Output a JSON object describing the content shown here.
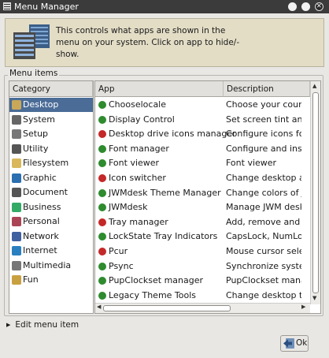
{
  "window": {
    "title": "Menu Manager"
  },
  "banner": {
    "text": "This controls what apps are shown in the menu on your system. Click on app to hide/-show."
  },
  "menu_items": {
    "label": "Menu items",
    "category_header": "Category",
    "categories": [
      {
        "label": "Desktop",
        "icon": "desktop-folder-icon",
        "selected": true
      },
      {
        "label": "System",
        "icon": "system-icon"
      },
      {
        "label": "Setup",
        "icon": "setup-tools-icon"
      },
      {
        "label": "Utility",
        "icon": "utility-gear-icon"
      },
      {
        "label": "Filesystem",
        "icon": "folder-icon"
      },
      {
        "label": "Graphic",
        "icon": "graphic-icon"
      },
      {
        "label": "Document",
        "icon": "document-icon"
      },
      {
        "label": "Business",
        "icon": "business-icon"
      },
      {
        "label": "Personal",
        "icon": "personal-icon"
      },
      {
        "label": "Network",
        "icon": "network-icon"
      },
      {
        "label": "Internet",
        "icon": "internet-globe-icon"
      },
      {
        "label": "Multimedia",
        "icon": "multimedia-icon"
      },
      {
        "label": "Fun",
        "icon": "fun-icon"
      }
    ],
    "app_header": "App",
    "description_header": "Description",
    "apps": [
      {
        "name": "Chooselocale",
        "desc": "Choose your country l",
        "status": "shown"
      },
      {
        "name": "Display Control",
        "desc": "Set screen tint and bri",
        "status": "shown"
      },
      {
        "name": "Desktop drive icons manager",
        "desc": "Configure icons for dri",
        "status": "hidden"
      },
      {
        "name": "Font manager",
        "desc": "Configure and install f",
        "status": "shown"
      },
      {
        "name": "Font viewer",
        "desc": "Font viewer",
        "status": "shown"
      },
      {
        "name": "Icon switcher",
        "desc": "Change desktop and m",
        "status": "hidden"
      },
      {
        "name": "JWMdesk Theme Manager",
        "desc": "Change colors of JWM",
        "status": "shown"
      },
      {
        "name": "JWMdesk",
        "desc": "Manage JWM desktop",
        "status": "shown"
      },
      {
        "name": "Tray manager",
        "desc": "Add, remove and edit",
        "status": "hidden"
      },
      {
        "name": "LockState Tray Indicators",
        "desc": "CapsLock, NumLock, S",
        "status": "shown"
      },
      {
        "name": "Pcur",
        "desc": "Mouse cursor selector",
        "status": "hidden"
      },
      {
        "name": "Psync",
        "desc": "Synchronize system t",
        "status": "shown"
      },
      {
        "name": "PupClockset manager",
        "desc": "PupClockset manager",
        "status": "shown"
      },
      {
        "name": "Legacy Theme Tools",
        "desc": "Change desktop them",
        "status": "shown"
      }
    ]
  },
  "edit_menu_item": {
    "label": "Edit menu item"
  },
  "ok_button": {
    "label": "Ok"
  },
  "colors": {
    "shown": "#2e8b2e",
    "hidden": "#c42828",
    "selection": "#4a6c97",
    "banner": "#e3ddc6"
  }
}
